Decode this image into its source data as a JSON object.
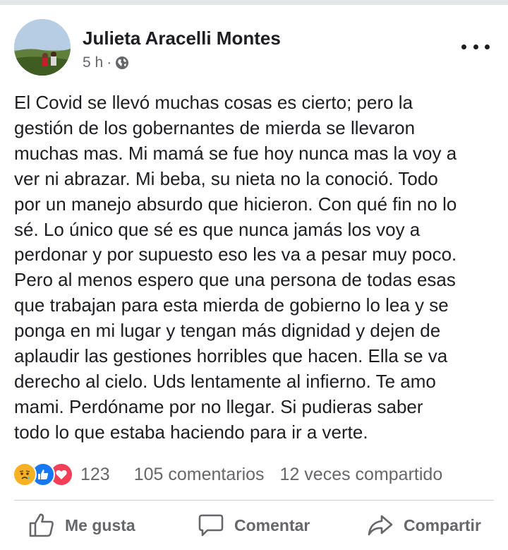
{
  "post": {
    "author": "Julieta Aracelli Montes",
    "time": "5 h",
    "separator": "·",
    "audience_icon": "globe-icon",
    "text": "El Covid se llevó muchas cosas es cierto; pero la\ngestión de los gobernantes de mierda se llevaron\nmuchas mas. Mi mamá se fue hoy nunca mas la voy a\nver ni abrazar. Mi beba, su nieta no la conoció. Todo\npor un manejo absurdo que hicieron. Con qué fin no lo\nsé. Lo único que sé es que nunca jamás los voy a\nperdonar y por supuesto eso les va a pesar muy poco.\nPero al menos espero que una persona de todas esas\nque trabajan para esta mierda de gobierno lo lea y se\nponga en mi lugar y tengan más dignidad y dejen de\naplaudir las gestiones horribles que hacen. Ella se va\nderecho al cielo. Uds lentamente al infierno. Te amo\nmami. Perdóname por no llegar. Si pudieras saber\ntodo lo que estaba haciendo para ir a verte."
  },
  "stats": {
    "reactions": [
      "sad-reaction-icon",
      "like-reaction-icon",
      "love-reaction-icon"
    ],
    "reaction_count": "123",
    "comments": "105 comentarios",
    "shares": "12 veces compartido"
  },
  "actions": {
    "like": "Me gusta",
    "comment": "Comentar",
    "share": "Compartir"
  },
  "colors": {
    "text": "#1c1e21",
    "secondary": "#65676b",
    "like_blue": "#1877f2",
    "love_red": "#f33e58",
    "sad_yellow": "#f7b125"
  }
}
